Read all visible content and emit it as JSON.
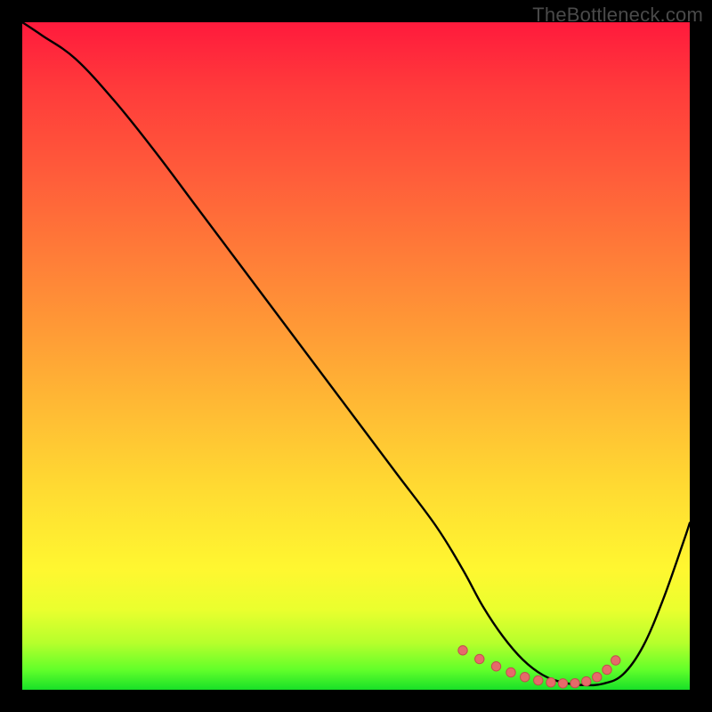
{
  "watermark": "TheBottleneck.com",
  "colors": {
    "background": "#000000",
    "curve_stroke": "#000000",
    "marker_fill": "#e66a6a",
    "marker_stroke": "#c24d4d"
  },
  "chart_data": {
    "type": "line",
    "title": "",
    "xlabel": "",
    "ylabel": "",
    "xlim": [
      0,
      100
    ],
    "ylim": [
      0,
      100
    ],
    "grid": false,
    "legend": false,
    "series": [
      {
        "name": "curve",
        "x": [
          0,
          3,
          8,
          14,
          20,
          26,
          32,
          38,
          44,
          50,
          56,
          62,
          66,
          69,
          72,
          75,
          78,
          81,
          84,
          87,
          90,
          93,
          96,
          99,
          100
        ],
        "y": [
          100,
          98,
          94.5,
          88,
          80.5,
          72.5,
          64.5,
          56.5,
          48.5,
          40.5,
          32.5,
          24.5,
          18,
          12.5,
          8,
          4.5,
          2.2,
          1.1,
          0.7,
          0.9,
          2.3,
          6.5,
          13.5,
          22,
          25
        ]
      }
    ],
    "markers": {
      "name": "optimal-range-dots",
      "x": [
        66,
        68.5,
        71,
        73.2,
        75.3,
        77.3,
        79.2,
        81,
        82.8,
        84.5,
        86.1,
        87.6,
        88.9
      ],
      "y": [
        5.9,
        4.6,
        3.5,
        2.6,
        1.9,
        1.4,
        1.1,
        0.95,
        0.98,
        1.25,
        1.9,
        3.0,
        4.4
      ]
    }
  }
}
